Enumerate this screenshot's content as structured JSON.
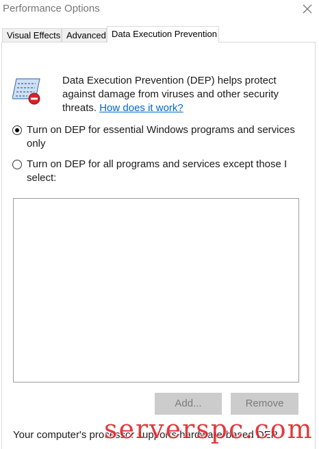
{
  "window": {
    "title": "Performance Options"
  },
  "tabs": [
    {
      "label": "Visual Effects"
    },
    {
      "label": "Advanced"
    },
    {
      "label": "Data Execution Prevention"
    }
  ],
  "dep": {
    "description": "Data Execution Prevention (DEP) helps protect against damage from viruses and other security threats.",
    "link_text": "How does it work?",
    "options": [
      {
        "label": "Turn on DEP for essential Windows programs and services only",
        "checked": true
      },
      {
        "label": "Turn on DEP for all programs and services except those I select:",
        "checked": false
      }
    ]
  },
  "buttons": {
    "add": "Add...",
    "remove": "Remove"
  },
  "footer": {
    "text": "Your computer's processor supports hardware-based DEP."
  },
  "watermark": {
    "text": "serverspc.com"
  },
  "colors": {
    "link": "#0066cc",
    "watermark": "#e0242a",
    "disabled_button": "#cccccc"
  }
}
